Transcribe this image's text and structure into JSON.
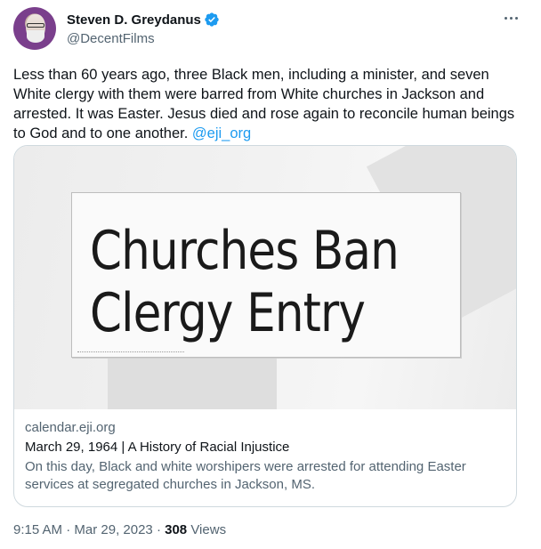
{
  "author": {
    "display_name": "Steven D. Greydanus",
    "handle": "@DecentFilms",
    "verified": true
  },
  "tweet": {
    "text": "Less than 60 years ago, three Black men, including a minister, and seven White clergy with them were barred from White churches in Jackson and arrested. It was Easter. Jesus died and rose again to reconcile human beings to God and to one another.",
    "mention": "@eji_org"
  },
  "card": {
    "image_headline_line1": "Churches Ban",
    "image_headline_line2": "Clergy Entry",
    "domain": "calendar.eji.org",
    "title": "March 29, 1964 | A History of Racial Injustice",
    "description": "On this day, Black and white worshipers were arrested for attending Easter services at segregated churches in Jackson, MS."
  },
  "footer": {
    "time": "9:15 AM",
    "separator": "·",
    "date": "Mar 29, 2023",
    "views_count": "308",
    "views_label": "Views"
  },
  "colors": {
    "accent": "#1d9bf0",
    "secondary_text": "#536471",
    "border": "#cfd9de"
  },
  "icons": {
    "verified": "verified-badge-icon",
    "more": "more-horizontal-icon"
  }
}
